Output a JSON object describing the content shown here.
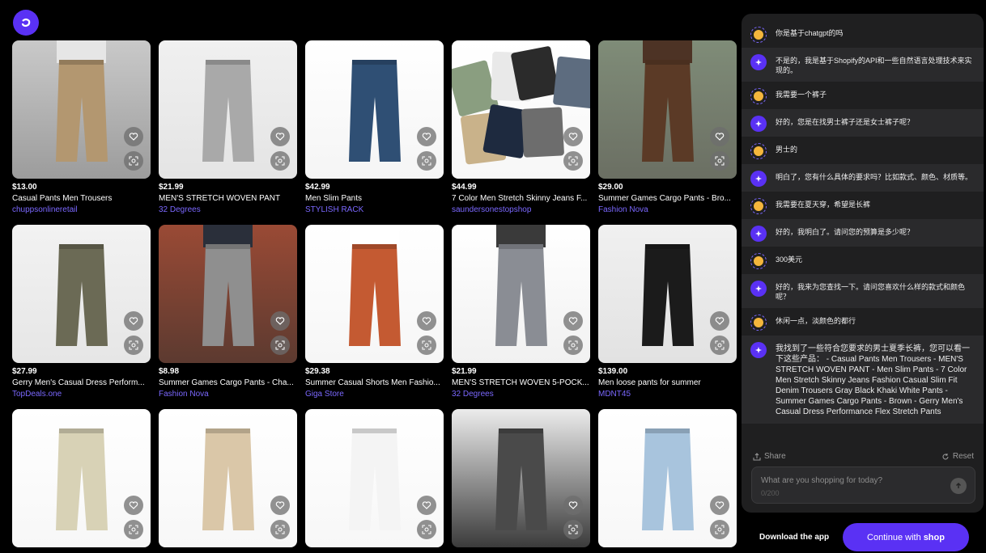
{
  "app": {
    "logo_icon": "shop-logo-icon",
    "brand_color": "#5a31f4",
    "store_color": "#7b68ff"
  },
  "products": [
    {
      "price": "$13.00",
      "name": "Casual Pants Men Trousers",
      "store": "chuppsonlineretail"
    },
    {
      "price": "$21.99",
      "name": "MEN'S STRETCH WOVEN PANT",
      "store": "32 Degrees"
    },
    {
      "price": "$42.99",
      "name": "Men Slim Pants",
      "store": "STYLISH RACK"
    },
    {
      "price": "$44.99",
      "name": "7 Color Men Stretch Skinny Jeans F...",
      "store": "saundersonestopshop"
    },
    {
      "price": "$29.00",
      "name": "Summer Games Cargo Pants - Bro...",
      "store": "Fashion Nova"
    },
    {
      "price": "$27.99",
      "name": "Gerry Men's Casual Dress Perform...",
      "store": "TopDeals.one"
    },
    {
      "price": "$8.98",
      "name": "Summer Games Cargo Pants - Cha...",
      "store": "Fashion Nova"
    },
    {
      "price": "$29.38",
      "name": "Summer Casual Shorts Men Fashio...",
      "store": "Giga Store"
    },
    {
      "price": "$21.99",
      "name": "MEN'S STRETCH WOVEN 5-POCK...",
      "store": "32 Degrees"
    },
    {
      "price": "$139.00",
      "name": "Men loose pants for summer",
      "store": "MDNT45"
    },
    {
      "price": "",
      "name": "",
      "store": ""
    },
    {
      "price": "",
      "name": "",
      "store": ""
    },
    {
      "price": "",
      "name": "",
      "store": ""
    },
    {
      "price": "",
      "name": "",
      "store": ""
    },
    {
      "price": "",
      "name": "",
      "store": ""
    }
  ],
  "chat": {
    "messages": [
      {
        "role": "user",
        "text": "你是基于chatgpt的吗"
      },
      {
        "role": "bot",
        "text": "不是的，我是基于Shopify的API和一些自然语言处理技术来实现的。"
      },
      {
        "role": "user",
        "text": "我需要一个裤子"
      },
      {
        "role": "bot",
        "text": "好的，您是在找男士裤子还是女士裤子呢？"
      },
      {
        "role": "user",
        "text": "男士的"
      },
      {
        "role": "bot",
        "text": "明白了，您有什么具体的要求吗？比如款式、颜色、材质等。"
      },
      {
        "role": "user",
        "text": "我需要在夏天穿，希望是长裤"
      },
      {
        "role": "bot",
        "text": "好的，我明白了。请问您的预算是多少呢？"
      },
      {
        "role": "user",
        "text": "300美元"
      },
      {
        "role": "bot",
        "text": "好的，我来为您查找一下。请问您喜欢什么样的款式和颜色呢？"
      },
      {
        "role": "user",
        "text": "休闲一点，淡颜色的都行"
      },
      {
        "role": "bot",
        "text": "我找到了一些符合您要求的男士夏季长裤，您可以看一下这些产品： - Casual Pants Men Trousers - MEN'S STRETCH WOVEN PANT - Men Slim Pants - 7 Color Men Stretch Skinny Jeans Fashion Casual Slim Fit Denim Trousers Gray Black Khaki White Pants - Summer Games Cargo Pants - Brown - Gerry Men's Casual Dress Performance Flex Stretch Pants"
      }
    ],
    "share_label": "Share",
    "reset_label": "Reset",
    "input_placeholder": "What are you shopping for today?",
    "char_count": "0/200"
  },
  "footer": {
    "download_label": "Download the app",
    "continue_prefix": "Continue with",
    "continue_brand": "shop"
  }
}
